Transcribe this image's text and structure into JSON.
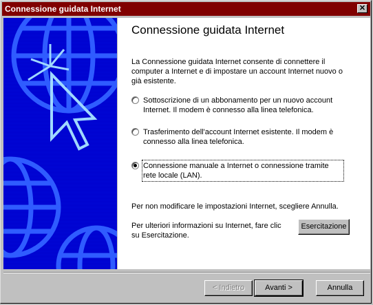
{
  "window": {
    "title": "Connessione guidata Internet",
    "close_label": "✕"
  },
  "page": {
    "heading": "Connessione guidata Internet",
    "intro": "La Connessione guidata Internet consente di connettere il computer a Internet e di impostare un account Internet nuovo o già esistente.",
    "options": [
      {
        "label": "Sottoscrizione di un abbonamento per un nuovo account Internet. Il modem è connesso alla linea telefonica.",
        "selected": false
      },
      {
        "label": "Trasferimento dell'account Internet esistente. Il modem è connesso alla linea telefonica.",
        "selected": false
      },
      {
        "label": "Connessione manuale a Internet o connessione tramite rete locale (LAN).",
        "selected": true
      }
    ],
    "cancel_note": "Per non modificare le impostazioni Internet, scegliere Annulla.",
    "tutorial_note": "Per ulteriori informazioni su Internet, fare clic su Esercitazione.",
    "tutorial_button": "Esercitazione"
  },
  "footer": {
    "back_button": "< Indietro",
    "next_button": "Avanti >",
    "cancel_button": "Annulla"
  },
  "colors": {
    "titlebar": "#800000",
    "banner": "#0000cc",
    "banner_lines": "#3b6fff"
  },
  "icons": {
    "banner_art": "globe-cursor-icon"
  }
}
